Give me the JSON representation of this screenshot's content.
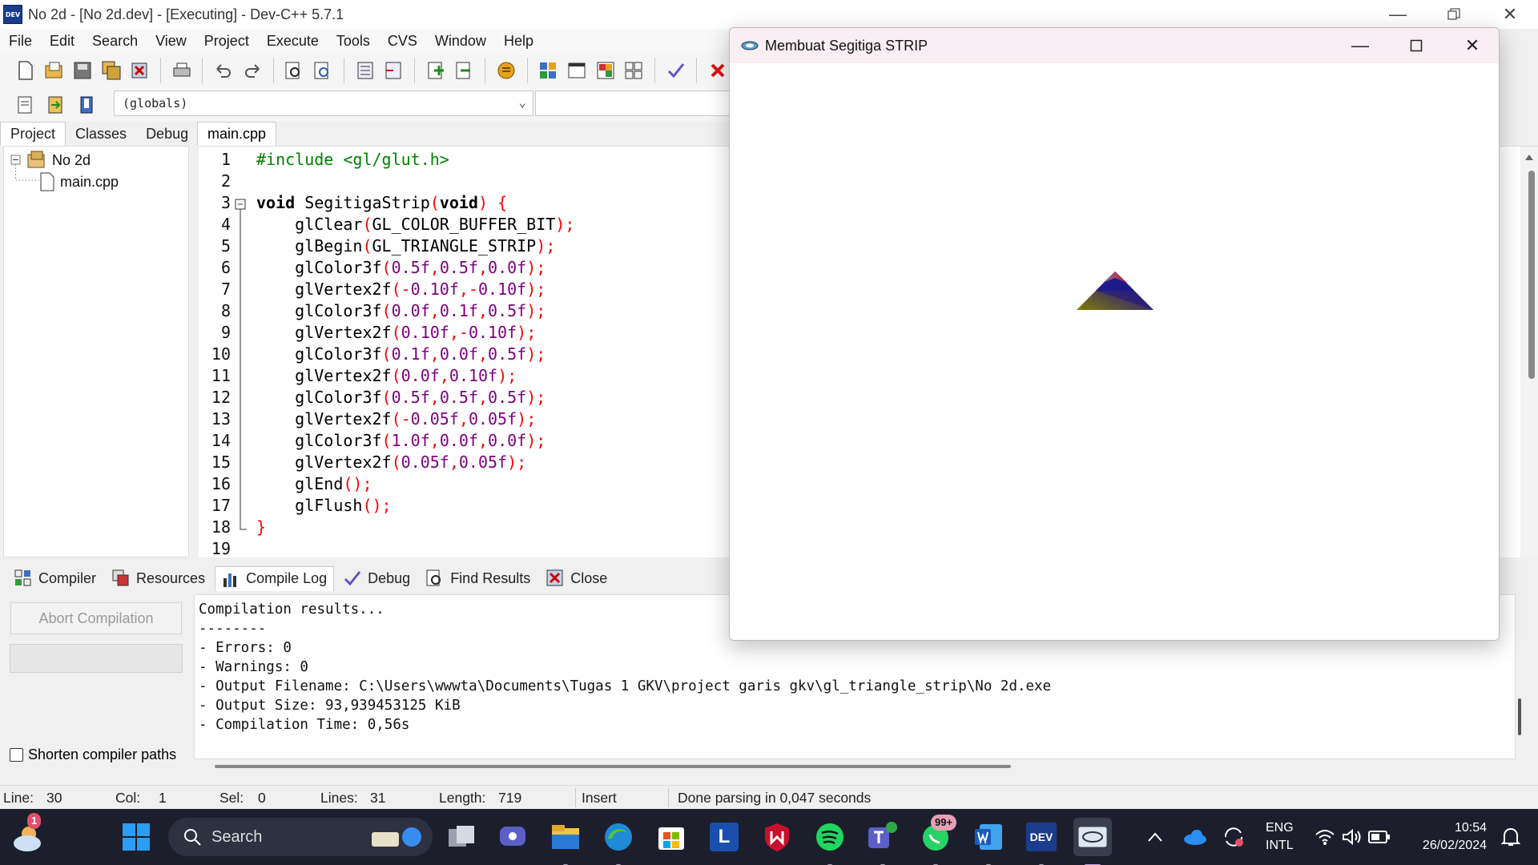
{
  "window": {
    "title": "No 2d - [No 2d.dev] - [Executing] - Dev-C++ 5.7.1",
    "app_icon_text": "DEV"
  },
  "menu": [
    "File",
    "Edit",
    "Search",
    "View",
    "Project",
    "Execute",
    "Tools",
    "CVS",
    "Window",
    "Help"
  ],
  "toolbar2": {
    "combo_value": "(globals)"
  },
  "left_tabs": [
    "Project",
    "Classes",
    "Debug"
  ],
  "tree": {
    "project": "No 2d",
    "file": "main.cpp"
  },
  "editor": {
    "tab": "main.cpp",
    "line_numbers": [
      "1",
      "2",
      "3",
      "4",
      "5",
      "6",
      "7",
      "8",
      "9",
      "10",
      "11",
      "12",
      "13",
      "14",
      "15",
      "16",
      "17",
      "18",
      "19"
    ]
  },
  "bottom_tabs": [
    "Compiler",
    "Resources",
    "Compile Log",
    "Debug",
    "Find Results",
    "Close"
  ],
  "compiler": {
    "abort_label": "Abort Compilation",
    "shorten_label": "Shorten compiler paths",
    "log": [
      "Compilation results...",
      "--------",
      "- Errors: 0",
      "- Warnings: 0",
      "- Output Filename: C:\\Users\\wwwta\\Documents\\Tugas 1 GKV\\project garis gkv\\gl_triangle_strip\\No 2d.exe",
      "- Output Size: 93,939453125 KiB",
      "- Compilation Time: 0,56s"
    ]
  },
  "status": {
    "line_label": "Line:",
    "line": "30",
    "col_label": "Col:",
    "col": "1",
    "sel_label": "Sel:",
    "sel": "0",
    "lines_label": "Lines:",
    "lines": "31",
    "length_label": "Length:",
    "length": "719",
    "mode": "Insert",
    "message": "Done parsing in 0,047 seconds"
  },
  "gl_window": {
    "title": "Membuat Segitiga STRIP"
  },
  "taskbar": {
    "search_label": "Search",
    "weather_badge": "1",
    "whatsapp_badge": "99+",
    "lang_top": "ENG",
    "lang_bottom": "INTL",
    "time": "10:54",
    "date": "26/02/2024",
    "dev_icon": "DEV",
    "lbox": "L"
  },
  "colors": {
    "accent": "#0078d4",
    "taskbar_bg": "#1c1f2b",
    "gl_title_bg": "#f9eef3"
  }
}
